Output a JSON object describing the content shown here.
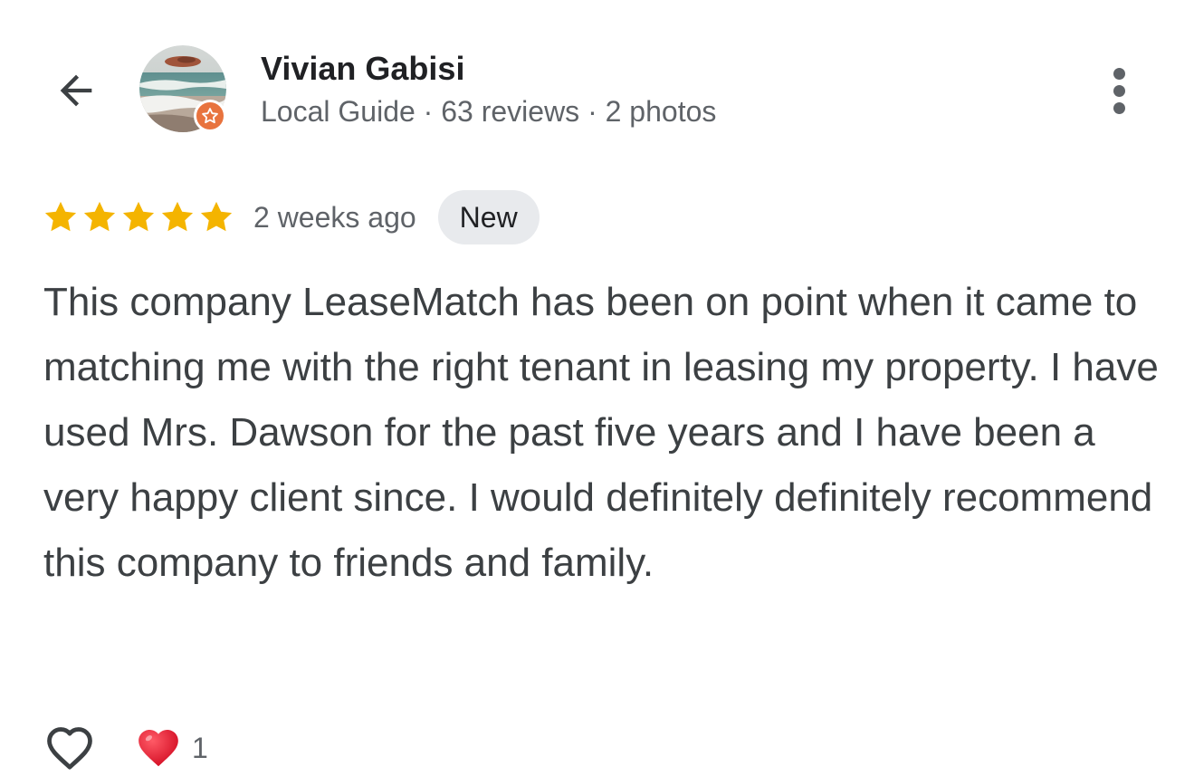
{
  "reviewer": {
    "name": "Vivian Gabisi",
    "meta": "Local Guide · 63 reviews · 2 photos",
    "badge_color": "#e8733e"
  },
  "review": {
    "rating": 5,
    "max_rating": 5,
    "time_ago": "2 weeks ago",
    "badge": "New",
    "text": "This company LeaseMatch has been on point when it came to matching me with the right tenant in leasing my property. I have used Mrs. Dawson for the past five years and I have been a very happy client since. I would definitely definitely recommend this company to friends and family."
  },
  "reactions": {
    "heart_count": "1"
  },
  "colors": {
    "star": "#f4b400",
    "text_primary": "#202124",
    "text_secondary": "#5f6368",
    "heart_red": "#e0122b"
  },
  "icons": {
    "back": "arrow-left-icon",
    "more": "more-vert-icon",
    "like": "heart-outline-icon",
    "reaction": "red-heart-icon",
    "badge": "local-guide-star-icon"
  }
}
